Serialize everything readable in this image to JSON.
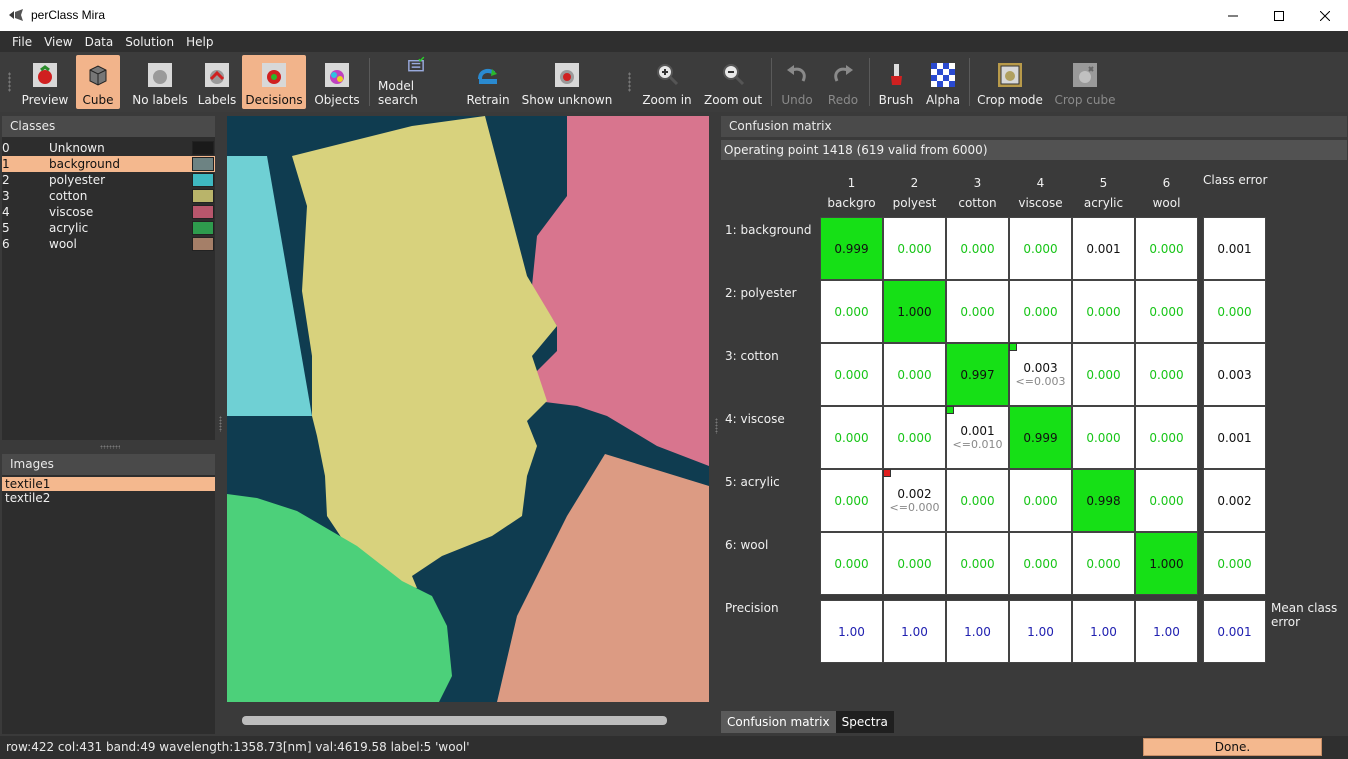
{
  "window": {
    "title": "perClass Mira"
  },
  "menu": [
    "File",
    "View",
    "Data",
    "Solution",
    "Help"
  ],
  "toolbar": {
    "preview": "Preview",
    "cube": "Cube",
    "no_labels": "No labels",
    "labels": "Labels",
    "decisions": "Decisions",
    "objects": "Objects",
    "model_search": "Model search",
    "retrain": "Retrain",
    "show_unknown": "Show unknown",
    "zoom_in": "Zoom in",
    "zoom_out": "Zoom out",
    "undo": "Undo",
    "redo": "Redo",
    "brush": "Brush",
    "alpha": "Alpha",
    "crop_mode": "Crop mode",
    "crop_cube": "Crop cube"
  },
  "classes": {
    "title": "Classes",
    "items": [
      {
        "index": "0",
        "name": "Unknown",
        "color": "#1a1a1a"
      },
      {
        "index": "1",
        "name": "background",
        "color": "#6d8383"
      },
      {
        "index": "2",
        "name": "polyester",
        "color": "#3fb8c0"
      },
      {
        "index": "3",
        "name": "cotton",
        "color": "#b9b46a"
      },
      {
        "index": "4",
        "name": "viscose",
        "color": "#b8566c"
      },
      {
        "index": "5",
        "name": "acrylic",
        "color": "#2e9b4d"
      },
      {
        "index": "6",
        "name": "wool",
        "color": "#a57f68"
      }
    ],
    "selected": 1
  },
  "images": {
    "title": "Images",
    "items": [
      "textile1",
      "textile2"
    ],
    "selected": 0
  },
  "confusion": {
    "title": "Confusion matrix",
    "operating_point": "Operating point 1418 (619 valid from 6000)",
    "col_numbers": [
      "1",
      "2",
      "3",
      "4",
      "5",
      "6"
    ],
    "col_names": [
      "backgro",
      "polyest",
      "cotton",
      "viscose",
      "acrylic",
      "wool"
    ],
    "class_error_label": "Class error",
    "row_labels": [
      "1: background",
      "2: polyester",
      "3: cotton",
      "4: viscose",
      "5: acrylic",
      "6: wool"
    ],
    "matrix": [
      [
        "0.999",
        "0.000",
        "0.000",
        "0.000",
        "0.001",
        "0.000"
      ],
      [
        "0.000",
        "1.000",
        "0.000",
        "0.000",
        "0.000",
        "0.000"
      ],
      [
        "0.000",
        "0.000",
        "0.997",
        "0.003",
        "0.000",
        "0.000"
      ],
      [
        "0.000",
        "0.000",
        "0.001",
        "0.999",
        "0.000",
        "0.000"
      ],
      [
        "0.000",
        "0.002",
        "0.000",
        "0.000",
        "0.998",
        "0.000"
      ],
      [
        "0.000",
        "0.000",
        "0.000",
        "0.000",
        "0.000",
        "1.000"
      ]
    ],
    "sub_notes": [
      {
        "row": 2,
        "col": 3,
        "text": "<=0.003"
      },
      {
        "row": 3,
        "col": 2,
        "text": "<=0.010"
      },
      {
        "row": 4,
        "col": 1,
        "text": "<=0.000"
      }
    ],
    "class_errors": [
      "0.001",
      "0.000",
      "0.003",
      "0.001",
      "0.002",
      "0.000"
    ],
    "precision_label": "Precision",
    "precision": [
      "1.00",
      "1.00",
      "1.00",
      "1.00",
      "1.00",
      "1.00"
    ],
    "mean_class_error_label": "Mean class error",
    "mean_class_error": "0.001"
  },
  "tabs": [
    "Confusion matrix",
    "Spectra"
  ],
  "status": {
    "text": "row:422 col:431 band:49 wavelength:1358.73[nm] val:4619.58 label:5 'wool'",
    "button": "Done."
  },
  "colors": {
    "accent": "#f4b88e",
    "diag_green": "#16e016",
    "value_green": "#18c518",
    "precision_blue": "#2020b0"
  }
}
